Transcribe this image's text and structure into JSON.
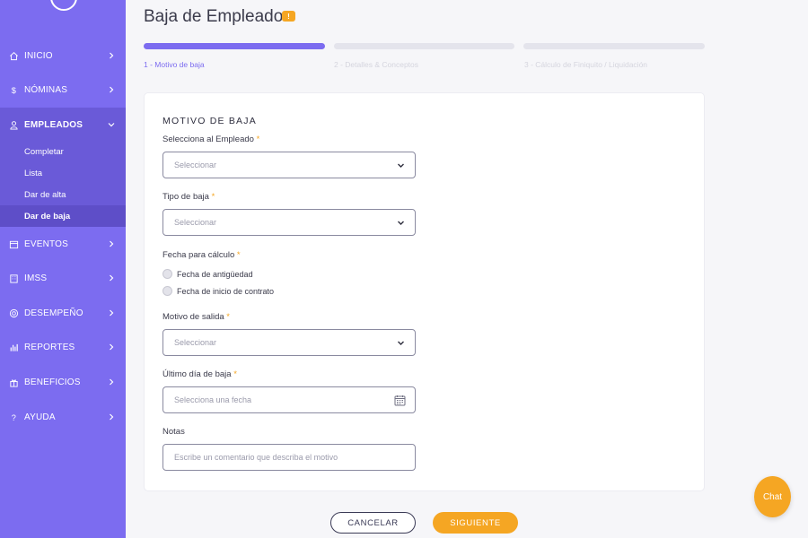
{
  "sidebar": {
    "items": [
      {
        "label": "INICIO",
        "icon": "home-icon"
      },
      {
        "label": "NÓMINAS",
        "icon": "dollar-icon"
      },
      {
        "label": "EMPLEADOS",
        "icon": "user-icon"
      },
      {
        "label": "EVENTOS",
        "icon": "calendar-icon"
      },
      {
        "label": "IMSS",
        "icon": "building-icon"
      },
      {
        "label": "DESEMPEÑO",
        "icon": "target-icon"
      },
      {
        "label": "REPORTES",
        "icon": "bar-chart-icon"
      },
      {
        "label": "BENEFICIOS",
        "icon": "gift-icon"
      },
      {
        "label": "AYUDA",
        "icon": "question-icon"
      }
    ],
    "submenu": [
      "Completar",
      "Lista",
      "Dar de alta",
      "Dar de baja"
    ]
  },
  "header": {
    "title": "Baja de Empleado",
    "badge": "!"
  },
  "steps": [
    {
      "label": "1 - Motivo de baja"
    },
    {
      "label": "2 - Detalles & Conceptos"
    },
    {
      "label": "3 - Cálculo de Finiquito / Liquidación"
    }
  ],
  "form": {
    "section_title": "MOTIVO DE BAJA",
    "required_mark": "*",
    "employee": {
      "label": "Selecciona al Empleado",
      "placeholder": "Seleccionar"
    },
    "type": {
      "label": "Tipo de baja",
      "placeholder": "Seleccionar"
    },
    "calc_date": {
      "label": "Fecha para cálculo",
      "options": [
        "Fecha de antigüedad",
        "Fecha de inicio de contrato"
      ]
    },
    "reason": {
      "label": "Motivo de salida",
      "placeholder": "Seleccionar"
    },
    "last_day": {
      "label": "Último día de baja",
      "placeholder": "Selecciona una fecha"
    },
    "notes": {
      "label": "Notas",
      "placeholder": "Escribe un comentario que describa el motivo"
    }
  },
  "buttons": {
    "cancel": "CANCELAR",
    "next": "SIGUIENTE"
  },
  "chat": {
    "label": "Chat"
  },
  "colors": {
    "sidebar": "#7c6cf0",
    "accent": "#f5a623",
    "primary": "#7c6cf0"
  }
}
